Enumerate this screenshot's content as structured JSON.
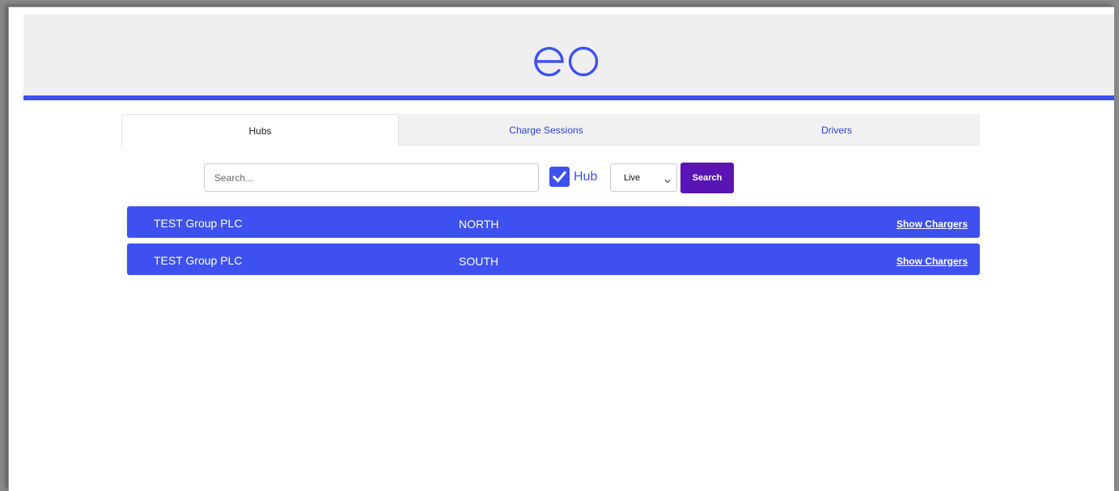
{
  "header": {
    "logo_text": "eo",
    "brand_color": "#3e51f0"
  },
  "tabs": [
    {
      "label": "Hubs",
      "active": true
    },
    {
      "label": "Charge Sessions",
      "active": false
    },
    {
      "label": "Drivers",
      "active": false
    }
  ],
  "filters": {
    "search_placeholder": "Search...",
    "search_value": "",
    "hub_checked": true,
    "hub_label": "Hub",
    "status_value": "Live",
    "search_button_label": "Search",
    "search_button_color": "#5a14b4"
  },
  "hubs": [
    {
      "company": "TEST Group PLC",
      "region": "NORTH",
      "action": "Show Chargers"
    },
    {
      "company": "TEST Group PLC",
      "region": "SOUTH",
      "action": "Show Chargers"
    }
  ]
}
